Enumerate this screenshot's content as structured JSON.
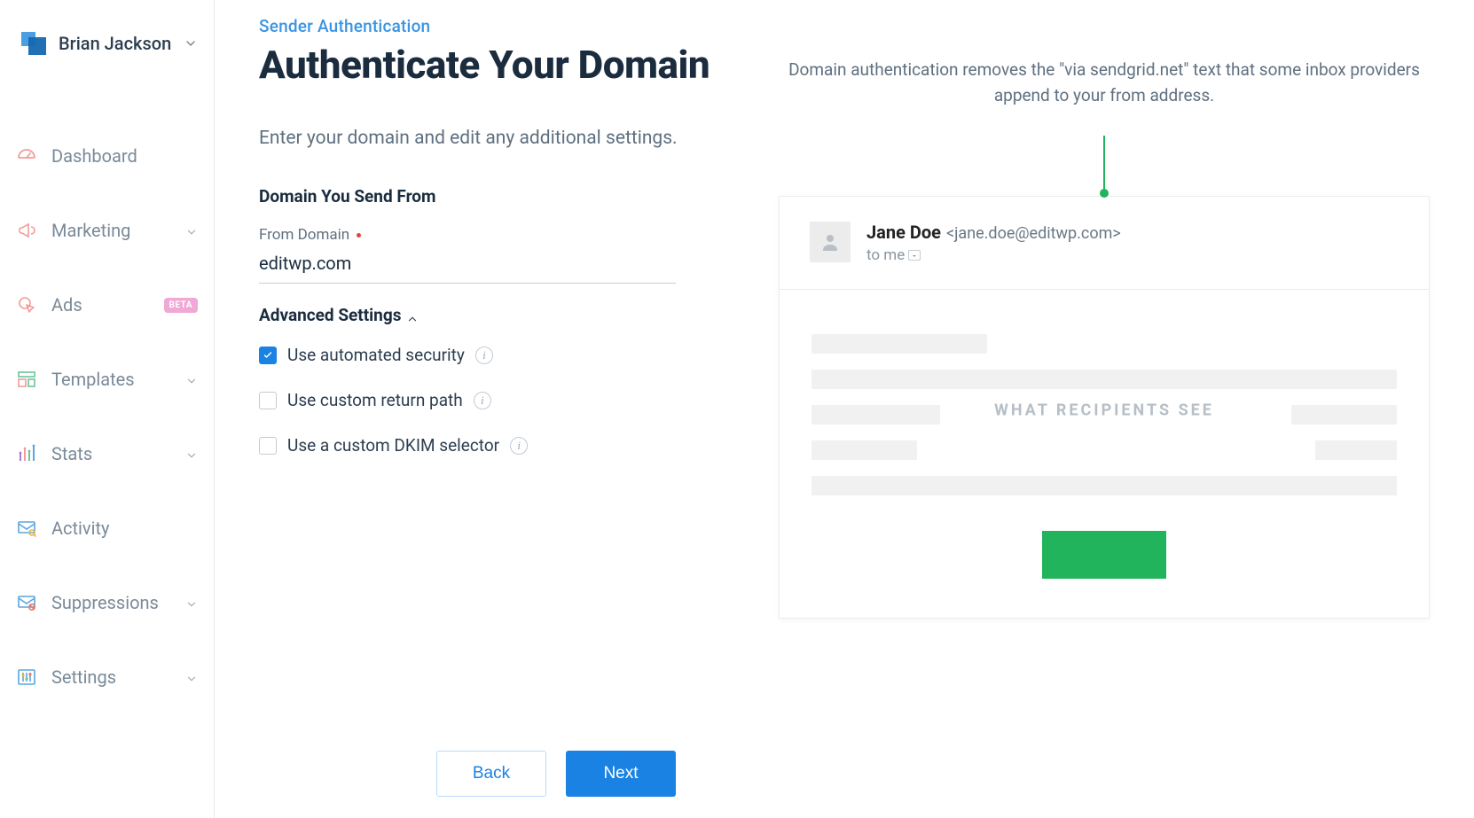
{
  "account": {
    "name": "Brian Jackson"
  },
  "sidebar": {
    "items": [
      {
        "label": "Dashboard",
        "icon": "gauge-icon",
        "chev": false,
        "badge": null
      },
      {
        "label": "Marketing",
        "icon": "megaphone-icon",
        "chev": true,
        "badge": null
      },
      {
        "label": "Ads",
        "icon": "cursor-icon",
        "chev": false,
        "badge": "BETA"
      },
      {
        "label": "Templates",
        "icon": "layout-icon",
        "chev": true,
        "badge": null
      },
      {
        "label": "Stats",
        "icon": "chart-icon",
        "chev": true,
        "badge": null
      },
      {
        "label": "Activity",
        "icon": "mail-search-icon",
        "chev": false,
        "badge": null
      },
      {
        "label": "Suppressions",
        "icon": "mail-block-icon",
        "chev": true,
        "badge": null
      },
      {
        "label": "Settings",
        "icon": "sliders-icon",
        "chev": true,
        "badge": null
      }
    ]
  },
  "breadcrumb": "Sender Authentication",
  "page_title": "Authenticate Your Domain",
  "lead": "Enter your domain and edit any additional settings.",
  "form": {
    "group_title": "Domain You Send From",
    "from_domain": {
      "label": "From Domain",
      "required": true,
      "value": "editwp.com"
    },
    "advanced": {
      "header": "Advanced Settings",
      "expanded": true,
      "options": [
        {
          "label": "Use automated security",
          "checked": true
        },
        {
          "label": "Use custom return path",
          "checked": false
        },
        {
          "label": "Use a custom DKIM selector",
          "checked": false
        }
      ]
    }
  },
  "actions": {
    "back": "Back",
    "next": "Next"
  },
  "preview": {
    "description": "Domain authentication removes the \"via sendgrid.net\" text that some inbox providers append to your from address.",
    "sender_name": "Jane Doe",
    "sender_email": "<jane.doe@editwp.com>",
    "to_label": "to me",
    "body_label": "WHAT RECIPIENTS SEE"
  }
}
